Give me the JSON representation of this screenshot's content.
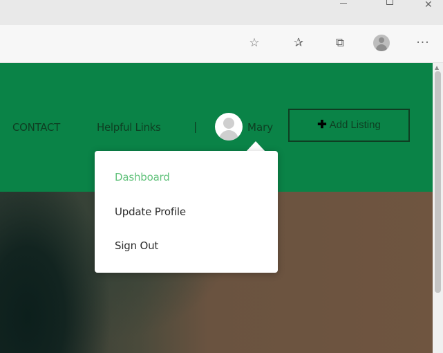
{
  "browser": {
    "window_controls": {
      "minimize_icon": "minimize-icon",
      "maximize_icon": "maximize-icon",
      "close_icon": "close-icon"
    },
    "toolbar": {
      "star_glyph": "☆",
      "favorites_glyph": "✰",
      "collections_glyph": "⧉",
      "more_glyph": "···"
    }
  },
  "site": {
    "nav": {
      "contact": "CONTACT",
      "helpful_links": "Helpful Links",
      "separator": "|",
      "user_name": "Mary",
      "add_listing": "Add Listing",
      "plus_glyph": "✚"
    },
    "user_menu": {
      "items": [
        {
          "label": "Dashboard",
          "active": true
        },
        {
          "label": "Update Profile",
          "active": false
        },
        {
          "label": "Sign Out",
          "active": false
        }
      ]
    }
  },
  "colors": {
    "nav_background": "#0a8347",
    "nav_text": "#0e3e22",
    "menu_active": "#61c27b",
    "menu_text": "#2c2c2c"
  }
}
